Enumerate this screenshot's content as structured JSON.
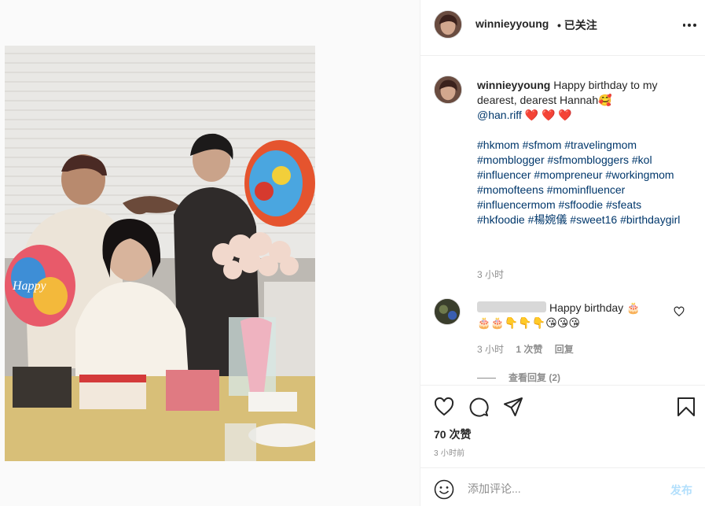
{
  "post": {
    "username": "winnieyyoung",
    "follow_status": "• 已关注"
  },
  "caption": {
    "username": "winnieyyoung",
    "text": "Happy birthday to my dearest, dearest Hannah🥰",
    "mention": "@han.riff",
    "hearts": "❤️ ❤️ ❤️",
    "hashtags": "#hkmom #sfmom #travelingmom #momblogger #sfmombloggers #kol #influencer #mompreneur #workingmom #momofteens #mominfluencer #influencermom #sffoodie #sfeats #hkfoodie #楊婉儀 #sweet16 #birthdaygirl",
    "time": "3 小时"
  },
  "comment": {
    "text": "Happy birthday 🎂",
    "text_line2": "🎂🎂👇👇👇😘😘😘",
    "time": "3 小时",
    "likes": "1 次赞",
    "reply": "回复",
    "view_replies": "查看回复 (2)"
  },
  "stats": {
    "likes": "70 次赞",
    "time_ago": "3 小时前"
  },
  "add_comment": {
    "placeholder": "添加评论...",
    "post_label": "发布"
  },
  "colors": {
    "link": "#00376b",
    "muted": "#8e8e8e",
    "border": "#efefef",
    "post_disabled": "#b2dffc"
  },
  "icons": [
    "more-icon",
    "heart-icon",
    "comment-icon",
    "share-icon",
    "save-icon",
    "emoji-icon"
  ]
}
